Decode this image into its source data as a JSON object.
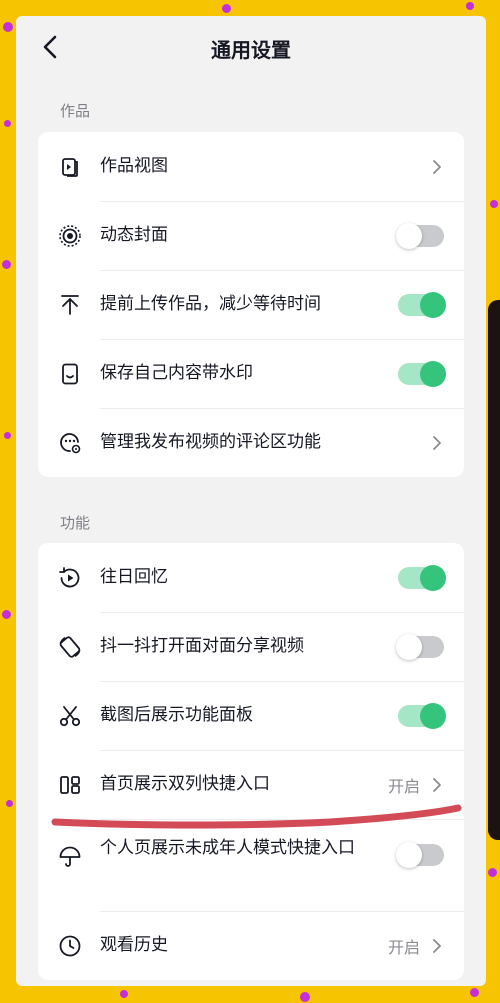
{
  "header": {
    "title": "通用设置"
  },
  "sections": [
    {
      "label": "作品",
      "items": [
        {
          "icon": "video-view-icon",
          "label": "作品视图",
          "control": "chevron"
        },
        {
          "icon": "live-cover-icon",
          "label": "动态封面",
          "control": "toggle",
          "on": false
        },
        {
          "icon": "upload-icon",
          "label": "提前上传作品，减少等待时间",
          "control": "toggle",
          "on": true
        },
        {
          "icon": "phone-watermark-icon",
          "label": "保存自己内容带水印",
          "control": "toggle",
          "on": true
        },
        {
          "icon": "comment-settings-icon",
          "label": "管理我发布视频的评论区功能",
          "control": "chevron"
        }
      ]
    },
    {
      "label": "功能",
      "items": [
        {
          "icon": "memories-icon",
          "label": "往日回忆",
          "control": "toggle",
          "on": true
        },
        {
          "icon": "shake-share-icon",
          "label": "抖一抖打开面对面分享视频",
          "control": "toggle",
          "on": false
        },
        {
          "icon": "scissors-icon",
          "label": "截图后展示功能面板",
          "control": "toggle",
          "on": true
        },
        {
          "icon": "double-column-icon",
          "label": "首页展示双列快捷入口",
          "control": "chevron",
          "value": "开启"
        },
        {
          "icon": "umbrella-icon",
          "label": "个人页展示未成年人模式快捷入口",
          "control": "toggle",
          "on": false
        },
        {
          "icon": "clock-icon",
          "label": "观看历史",
          "control": "chevron",
          "value": "开启"
        }
      ]
    }
  ],
  "colors": {
    "toggle_on_track": "#a4e6c6",
    "toggle_on_knob": "#35c47b",
    "toggle_off_track": "#c9cacd",
    "annotation_stroke": "#d24b57",
    "background": "#f6c400"
  }
}
